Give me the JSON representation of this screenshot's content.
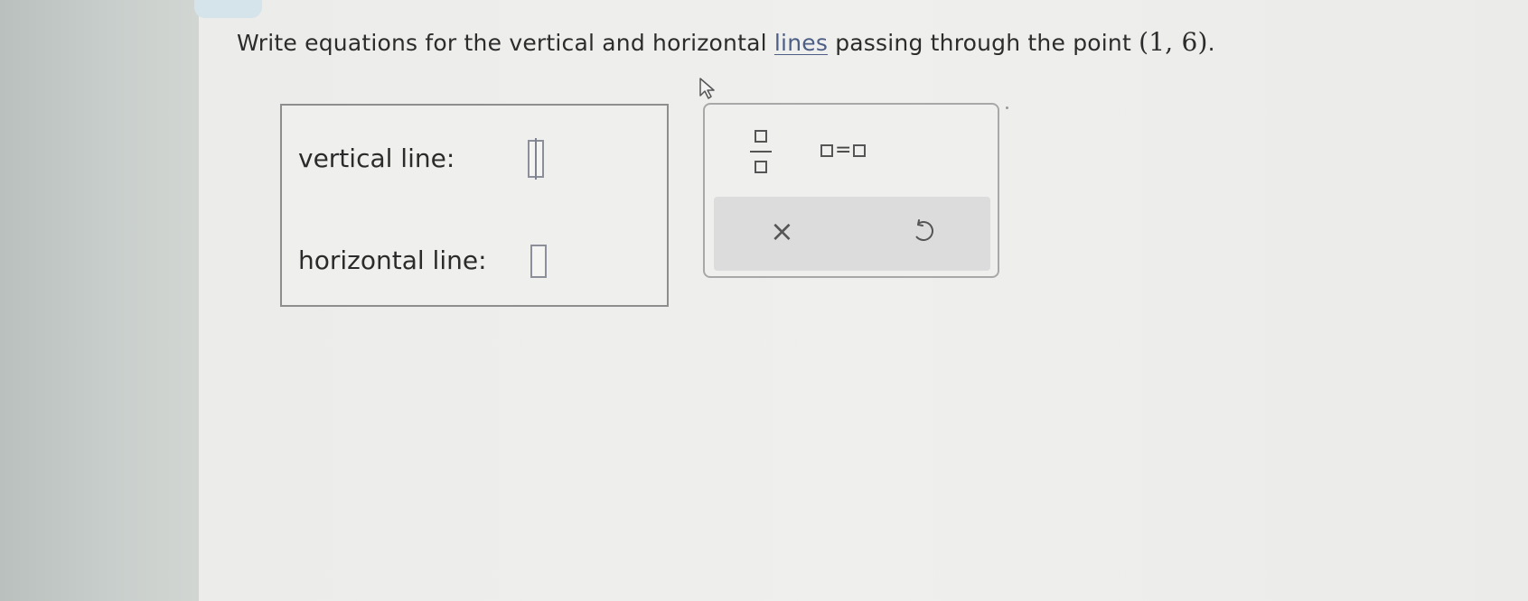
{
  "question": {
    "text_before": "Write equations for the vertical and horizontal ",
    "link_text": "lines",
    "text_after": " passing through the point ",
    "point": "(1, 6)",
    "end": "."
  },
  "answers": {
    "vertical_label": "vertical line:",
    "vertical_value": "",
    "horizontal_label": "horizontal line:",
    "horizontal_value": ""
  },
  "palette": {
    "equals_symbol": "=",
    "clear_symbol": "×"
  },
  "icons": [
    "cursor-icon",
    "fraction-icon",
    "equation-icon",
    "clear-icon",
    "undo-icon"
  ]
}
